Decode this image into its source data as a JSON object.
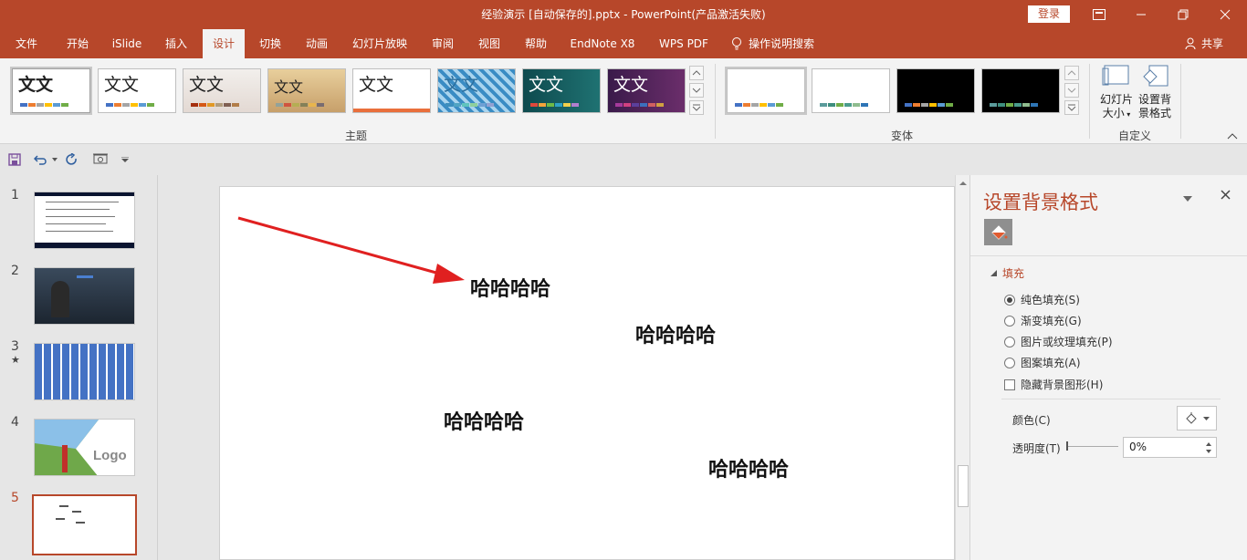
{
  "window": {
    "title": "经验演示 [自动保存的].pptx  -  PowerPoint(产品激活失败)",
    "login": "登录"
  },
  "menu": {
    "tabs": [
      "文件",
      "开始",
      "iSlide",
      "插入",
      "设计",
      "切换",
      "动画",
      "幻灯片放映",
      "审阅",
      "视图",
      "帮助",
      "EndNote X8",
      "WPS PDF"
    ],
    "active": "设计",
    "tell_me": "操作说明搜索",
    "share": "共享"
  },
  "ribbon": {
    "themes_label": "主题",
    "variants_label": "变体",
    "customize_label": "自定义",
    "theme_sample_text": "文文",
    "slide_size_label": [
      "幻灯片",
      "大小"
    ],
    "format_bg_label": [
      "设置背",
      "景格式"
    ]
  },
  "slides": {
    "numbers": [
      "1",
      "2",
      "3",
      "4",
      "5"
    ],
    "slide3_marker": "★",
    "thumb4_logo": "Logo",
    "active": "5"
  },
  "canvas": {
    "texts": [
      "哈哈哈哈",
      "哈哈哈哈",
      "哈哈哈哈",
      "哈哈哈哈"
    ]
  },
  "pane": {
    "title": "设置背景格式",
    "section": "填充",
    "options": [
      "纯色填充(S)",
      "渐变填充(G)",
      "图片或纹理填充(P)",
      "图案填充(A)"
    ],
    "selected_option": "纯色填充(S)",
    "hide_bg": "隐藏背景图形(H)",
    "color_label": "颜色(C)",
    "transparency_label": "透明度(T)",
    "transparency_value": "0%"
  },
  "colors": {
    "accent": "#b7472a",
    "arrow": "#e02020"
  }
}
